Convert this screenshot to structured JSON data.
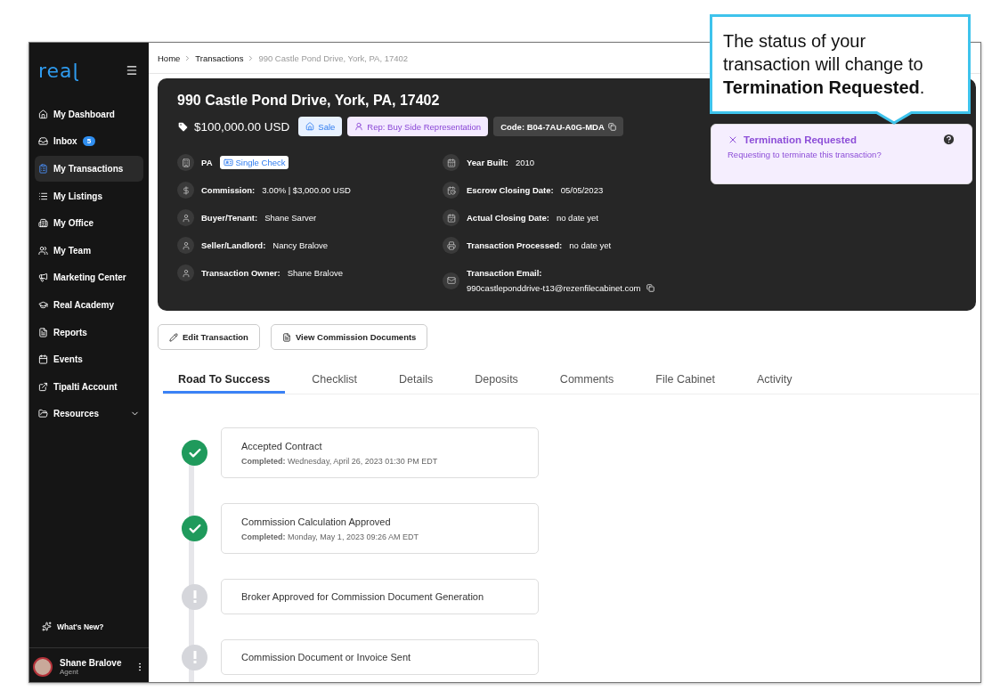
{
  "sidebar": {
    "logo": "reaɭ",
    "items": [
      {
        "label": "My Dashboard",
        "selected": false
      },
      {
        "label": "Inbox",
        "selected": false,
        "badge": "5"
      },
      {
        "label": "My Transactions",
        "selected": true
      },
      {
        "label": "My Listings",
        "selected": false
      },
      {
        "label": "My Office",
        "selected": false
      },
      {
        "label": "My Team",
        "selected": false
      },
      {
        "label": "Marketing Center",
        "selected": false
      },
      {
        "label": "Real Academy",
        "selected": false
      },
      {
        "label": "Reports",
        "selected": false
      },
      {
        "label": "Events",
        "selected": false
      },
      {
        "label": "Tipalti Account",
        "selected": false
      },
      {
        "label": "Resources",
        "selected": false,
        "expanded": false
      }
    ],
    "whats_new": "What's New?",
    "user": {
      "name": "Shane Bralove",
      "role": "Agent"
    }
  },
  "breadcrumb": [
    "Home",
    "Transactions",
    "990 Castle Pond Drive, York, PA, 17402"
  ],
  "transaction": {
    "address": "990 Castle Pond Drive, York, PA, 17402",
    "price": "$100,000.00 USD",
    "tags": [
      {
        "kind": "sale",
        "label": "Sale"
      },
      {
        "kind": "rep",
        "label": "Rep: Buy Side Representation"
      },
      {
        "kind": "code",
        "label": "Code: B04-7AU-A0G-MDA"
      }
    ],
    "state": "PA",
    "check_type": "Single Check",
    "details_left": [
      {
        "label": "Commission:",
        "value": "3.00% | $3,000.00 USD"
      },
      {
        "label": "Buyer/Tenant:",
        "value": "Shane Sarver"
      },
      {
        "label": "Seller/Landlord:",
        "value": "Nancy Bralove"
      },
      {
        "label": "Transaction Owner:",
        "value": "Shane Bralove"
      }
    ],
    "details_right": [
      {
        "label": "Year Built:",
        "value": "2010"
      },
      {
        "label": "Escrow Closing Date:",
        "value": "05/05/2023"
      },
      {
        "label": "Actual Closing Date:",
        "value": "no date yet"
      },
      {
        "label": "Transaction Processed:",
        "value": "no date yet"
      }
    ],
    "email": {
      "label": "Transaction Email:",
      "value": "990castleponddrive-t13@rezenfilecabinet.com"
    }
  },
  "status_card": {
    "title": "Termination Requested",
    "subtitle": "Requesting to terminate this transaction?"
  },
  "actions": [
    "Edit Transaction",
    "View Commission Documents"
  ],
  "tabs": [
    {
      "label": "Road To Success",
      "selected": true
    },
    {
      "label": "Checklist",
      "selected": false
    },
    {
      "label": "Details",
      "selected": false
    },
    {
      "label": "Deposits",
      "selected": false
    },
    {
      "label": "Comments",
      "selected": false
    },
    {
      "label": "File Cabinet",
      "selected": false
    },
    {
      "label": "Activity",
      "selected": false
    }
  ],
  "steps": [
    {
      "title": "Accepted Contract",
      "completed": true,
      "detail_label": "Completed:",
      "detail": "Wednesday, April 26, 2023 01:30 PM EDT"
    },
    {
      "title": "Commission Calculation Approved",
      "completed": true,
      "detail_label": "Completed:",
      "detail": "Monday, May 1, 2023 09:26 AM EDT"
    },
    {
      "title": "Broker Approved for Commission Document Generation",
      "completed": false
    },
    {
      "title": "Commission Document or Invoice Sent",
      "completed": false
    }
  ],
  "callout": {
    "text": "The status of your transaction will change to **Termination Requested**."
  }
}
